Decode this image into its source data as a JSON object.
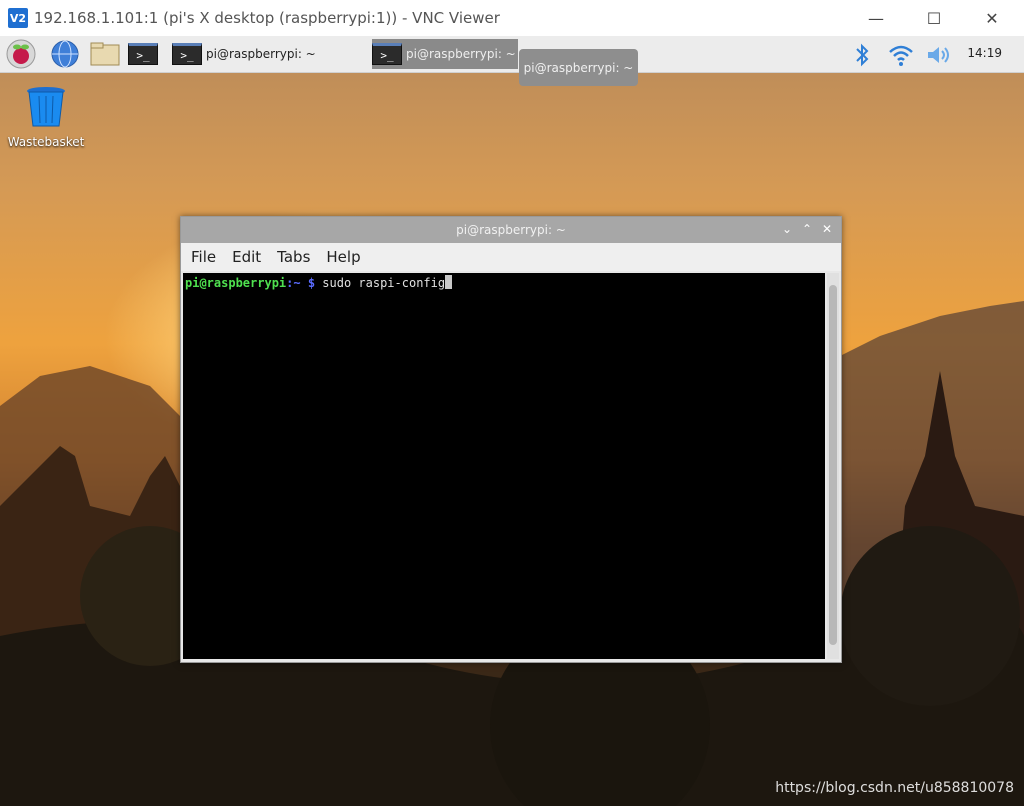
{
  "vnc_window": {
    "logo": "V2",
    "title": "192.168.1.101:1 (pi's X desktop (raspberrypi:1)) - VNC Viewer",
    "controls": {
      "minimize": "—",
      "maximize": "☐",
      "close": "✕"
    }
  },
  "panel": {
    "tasks": [
      {
        "label": "pi@raspberrypi: ~"
      },
      {
        "label": "pi@raspberrypi: ~"
      }
    ],
    "tooltip": "pi@raspberrypi: ~",
    "clock": "14:19"
  },
  "desktop": {
    "icons": [
      {
        "label": "Wastebasket",
        "icon": "wastebasket-icon"
      }
    ]
  },
  "terminal": {
    "title": "pi@raspberrypi: ~",
    "menu": [
      "File",
      "Edit",
      "Tabs",
      "Help"
    ],
    "prompt_user": "pi@raspberrypi",
    "prompt_path": ":~ $",
    "command": " sudo raspi-config"
  },
  "watermark": "https://blog.csdn.net/u858810078"
}
